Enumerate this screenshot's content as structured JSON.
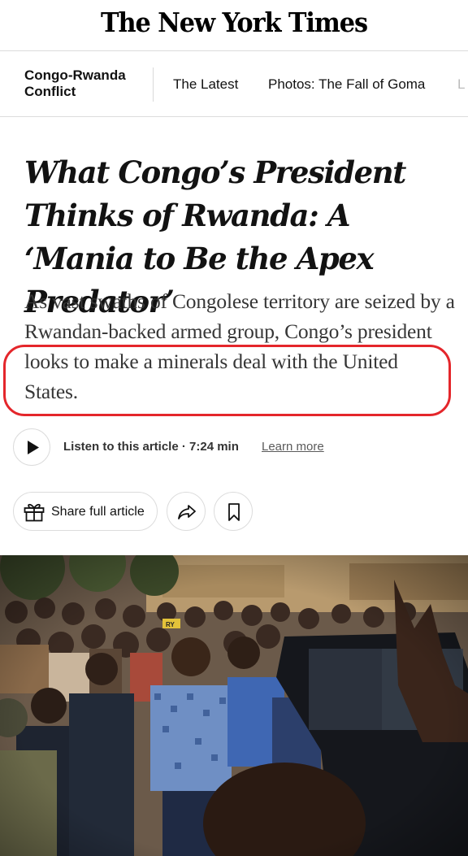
{
  "masthead": {
    "logo_text": "The New York Times"
  },
  "nav": {
    "section": "Congo-Rwanda Conflict",
    "links": [
      "The Latest",
      "Photos: The Fall of Goma",
      "L"
    ]
  },
  "article": {
    "headline": "What Congo’s President Thinks of Rwanda: A ‘Mania to Be the Apex Predator’",
    "summary": "As vast swaths of Congolese territory are seized by a Rwandan-backed armed group, Congo’s president looks to make a minerals deal with the United States."
  },
  "audio": {
    "listen_text": "Listen to this article · 7:24 min",
    "learn_more": "Learn more"
  },
  "actions": {
    "share_label": "Share full article"
  },
  "photo": {
    "cap_text": "RY"
  },
  "colors": {
    "highlight": "#e4262b",
    "text": "#121212",
    "summary": "#363636"
  },
  "icons": [
    "play-icon",
    "gift-icon",
    "share-arrow-icon",
    "bookmark-icon"
  ]
}
